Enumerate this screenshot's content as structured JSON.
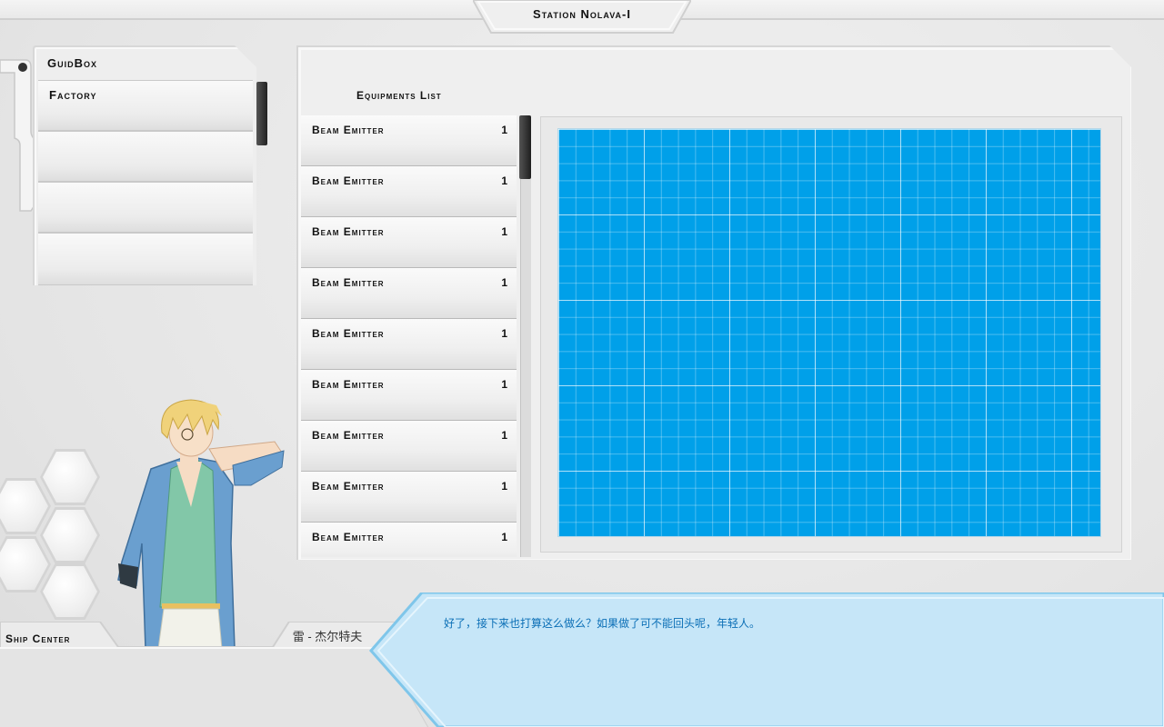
{
  "header": {
    "station_title": "Station Nolava-I"
  },
  "menu": {
    "header": "GuidBox",
    "items": [
      {
        "label": "Factory"
      },
      {
        "label": ""
      },
      {
        "label": ""
      },
      {
        "label": ""
      }
    ]
  },
  "equipment": {
    "title": "Equipments List",
    "items": [
      {
        "name": "Beam Emitter",
        "qty": "1"
      },
      {
        "name": "Beam Emitter",
        "qty": "1"
      },
      {
        "name": "Beam Emitter",
        "qty": "1"
      },
      {
        "name": "Beam Emitter",
        "qty": "1"
      },
      {
        "name": "Beam Emitter",
        "qty": "1"
      },
      {
        "name": "Beam Emitter",
        "qty": "1"
      },
      {
        "name": "Beam Emitter",
        "qty": "1"
      },
      {
        "name": "Beam Emitter",
        "qty": "1"
      },
      {
        "name": "Beam Emitter",
        "qty": "1"
      }
    ]
  },
  "blueprint": {
    "color": "#00a0e9"
  },
  "bottom": {
    "location_label": "Ship Center",
    "speaker": "雷 - 杰尔特夫",
    "dialog": "好了，接下来也打算这么做么？如果做了可不能回头呢，年轻人。"
  },
  "colors": {
    "accent": "#00a0e9",
    "dialog_text": "#0b6fb6",
    "dialog_bg": "#c6e6f8"
  }
}
